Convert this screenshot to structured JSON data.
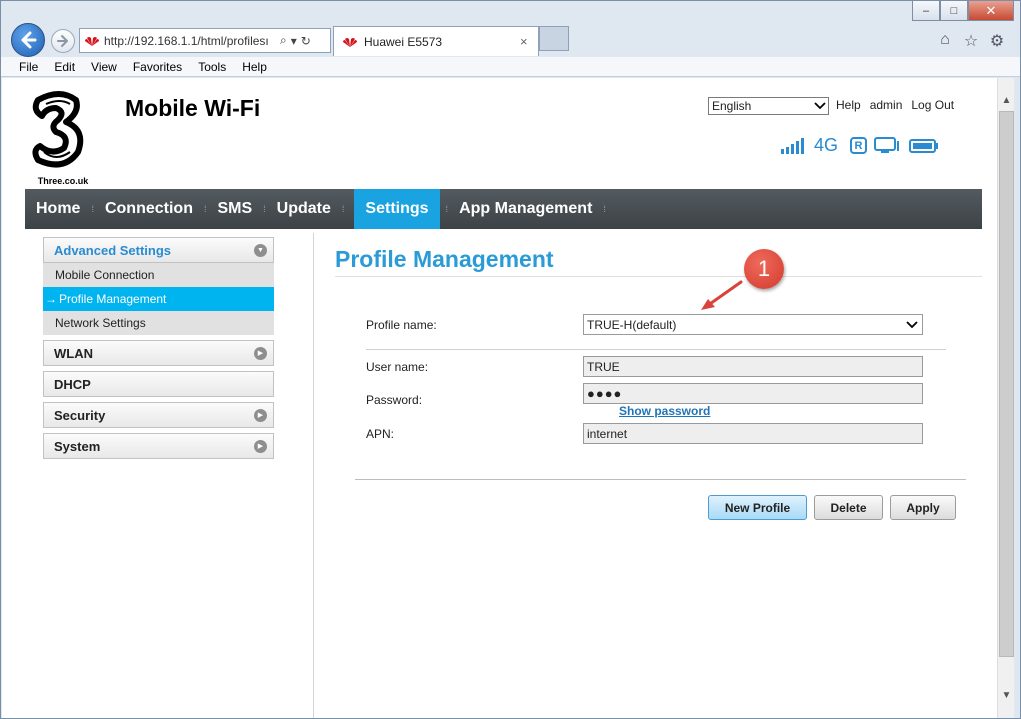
{
  "browser": {
    "url": "http://192.168.1.1/html/profilesı",
    "tab_title": "Huawei E5573",
    "tab_close": "×",
    "menu": [
      "File",
      "Edit",
      "View",
      "Favorites",
      "Tools",
      "Help"
    ],
    "window_controls": {
      "minimize": "–",
      "maximize": "□",
      "close": "✕"
    }
  },
  "header": {
    "logo_domain": "Three.co.uk",
    "title": "Mobile Wi-Fi",
    "language": "English",
    "links": {
      "help": "Help",
      "user": "admin",
      "logout": "Log Out"
    },
    "network_type": "4G",
    "roaming": "R"
  },
  "nav": {
    "items": [
      {
        "label": "Home",
        "active": false
      },
      {
        "label": "Connection",
        "active": false
      },
      {
        "label": "SMS",
        "active": false
      },
      {
        "label": "Update",
        "active": false
      },
      {
        "label": "Settings",
        "active": true
      },
      {
        "label": "App Management",
        "active": false
      }
    ]
  },
  "sidebar": {
    "advanced": "Advanced Settings",
    "subitems": [
      "Mobile Connection",
      "Profile Management",
      "Network Settings"
    ],
    "active_prefix": "→",
    "wlan": "WLAN",
    "dhcp": "DHCP",
    "security": "Security",
    "system": "System"
  },
  "main": {
    "title": "Profile Management",
    "annotation": "1",
    "profile_name_label": "Profile name:",
    "profile_name_value": "TRUE-H(default)",
    "username_label": "User name:",
    "username_value": "TRUE",
    "password_label": "Password:",
    "password_value": "●●●●",
    "show_password": "Show password",
    "apn_label": "APN:",
    "apn_value": "internet",
    "buttons": {
      "new_profile": "New Profile",
      "delete": "Delete",
      "apply": "Apply"
    }
  },
  "colors": {
    "accent": "#19a3e0",
    "title": "#2a9bd6",
    "navbar": "#4a5055",
    "annotation": "#d9443a"
  }
}
